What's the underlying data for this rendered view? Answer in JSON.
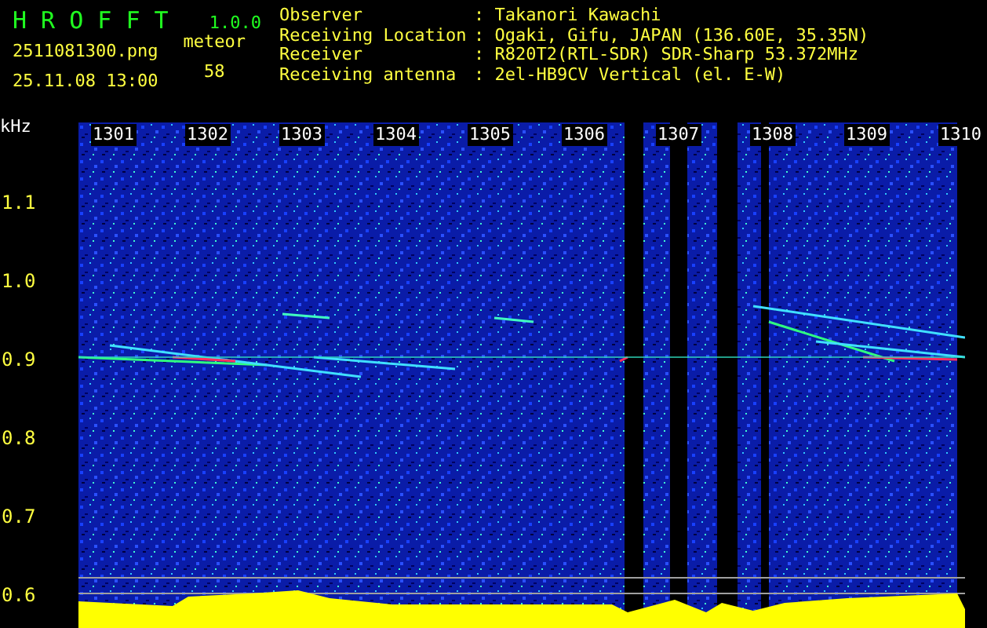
{
  "app": {
    "title": "H R O F F T",
    "version": "1.0.0"
  },
  "file": {
    "name": "2511081300.png",
    "datetime": "25.11.08 13:00"
  },
  "meteor": {
    "label": "meteor",
    "count": "58"
  },
  "info": [
    {
      "label": "Observer",
      "value": ": Takanori Kawachi"
    },
    {
      "label": "Receiving Location",
      "value": ": Ogaki, Gifu, JAPAN (136.60E, 35.35N)"
    },
    {
      "label": "Receiver",
      "value": ": R820T2(RTL-SDR) SDR-Sharp 53.372MHz"
    },
    {
      "label": "Receiving antenna",
      "value": ": 2el-HB9CV Vertical (el. E-W)"
    }
  ],
  "spectrogram": {
    "unit": "kHz",
    "time_labels": [
      "1301",
      "1302",
      "1303",
      "1304",
      "1305",
      "1306",
      "1307",
      "1308",
      "1309",
      "1310"
    ],
    "freq_labels": [
      "1.1",
      "1.0",
      "0.9",
      "0.8",
      "0.7",
      "0.6"
    ]
  }
}
